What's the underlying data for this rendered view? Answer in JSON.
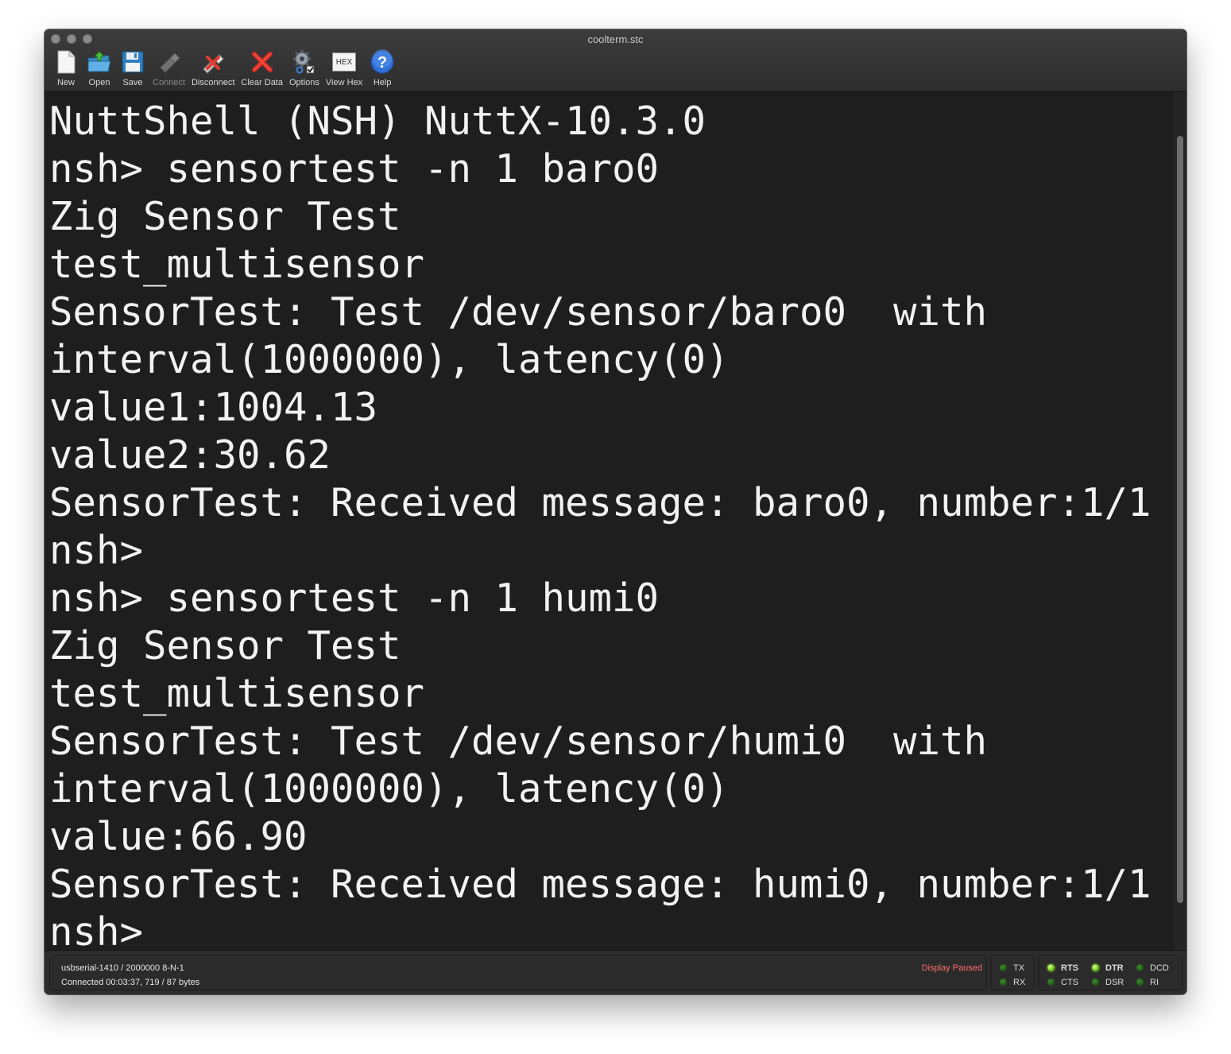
{
  "window": {
    "title": "coolterm.stc"
  },
  "toolbar": [
    {
      "label": "New",
      "icon": "new-document-icon",
      "enabled": true
    },
    {
      "label": "Open",
      "icon": "open-folder-icon",
      "enabled": true
    },
    {
      "label": "Save",
      "icon": "floppy-disk-icon",
      "enabled": true
    },
    {
      "label": "Connect",
      "icon": "connect-plug-icon",
      "enabled": false
    },
    {
      "label": "Disconnect",
      "icon": "disconnect-plug-icon",
      "enabled": true
    },
    {
      "label": "Clear Data",
      "icon": "red-x-icon",
      "enabled": true
    },
    {
      "label": "Options",
      "icon": "gear-options-icon",
      "enabled": true
    },
    {
      "label": "View Hex",
      "icon": "hex-view-icon",
      "enabled": true,
      "badge": "HEX"
    },
    {
      "label": "Help",
      "icon": "help-question-icon",
      "enabled": true
    }
  ],
  "terminal": {
    "lines": [
      "NuttShell (NSH) NuttX-10.3.0",
      "nsh> sensortest -n 1 baro0",
      "Zig Sensor Test",
      "test_multisensor",
      "SensorTest: Test /dev/sensor/baro0  with",
      "interval(1000000), latency(0)",
      "value1:1004.13",
      "value2:30.62",
      "SensorTest: Received message: baro0, number:1/1",
      "nsh>",
      "nsh> sensortest -n 1 humi0",
      "Zig Sensor Test",
      "test_multisensor",
      "SensorTest: Test /dev/sensor/humi0  with",
      "interval(1000000), latency(0)",
      "value:66.90",
      "SensorTest: Received message: humi0, number:1/1",
      "nsh>"
    ]
  },
  "status": {
    "port_line": "usbserial-1410 / 2000000 8-N-1",
    "connection_line": "Connected 00:03:37, 719 / 87 bytes",
    "display_state": "Display Paused",
    "leds": {
      "TX": false,
      "RX": false,
      "RTS": true,
      "CTS": false,
      "DTR": true,
      "DSR": false,
      "DCD": false,
      "RI": false
    },
    "labels": {
      "TX": "TX",
      "RX": "RX",
      "RTS": "RTS",
      "CTS": "CTS",
      "DTR": "DTR",
      "DSR": "DSR",
      "DCD": "DCD",
      "RI": "RI"
    }
  },
  "colors": {
    "terminal_bg": "#1e1e1e",
    "terminal_fg": "#f2f2f2",
    "paused": "#ff6b6b",
    "led_on": "#7cd42a"
  }
}
